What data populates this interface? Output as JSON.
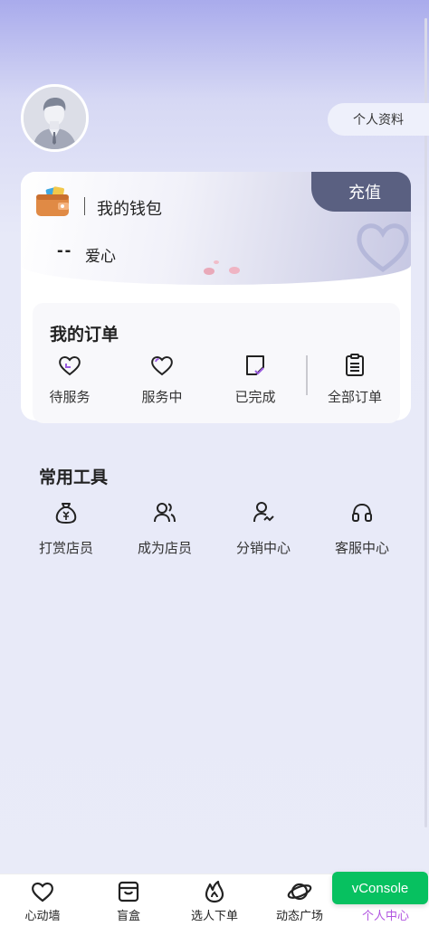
{
  "profile": {
    "profile_button_label": "个人资料"
  },
  "wallet": {
    "title": "我的钱包",
    "recharge_label": "充值",
    "balance": "--",
    "unit": "爱心"
  },
  "orders": {
    "title": "我的订单",
    "items": [
      {
        "label": "待服务",
        "icon": "heart-check-icon"
      },
      {
        "label": "服务中",
        "icon": "heart-icon"
      },
      {
        "label": "已完成",
        "icon": "document-check-icon"
      },
      {
        "label": "全部订单",
        "icon": "clipboard-list-icon"
      }
    ]
  },
  "tools": {
    "title": "常用工具",
    "items": [
      {
        "label": "打赏店员",
        "icon": "money-bag-icon"
      },
      {
        "label": "成为店员",
        "icon": "users-icon"
      },
      {
        "label": "分销中心",
        "icon": "user-share-icon"
      },
      {
        "label": "客服中心",
        "icon": "headset-icon"
      }
    ]
  },
  "tabbar": {
    "items": [
      {
        "label": "心动墙",
        "icon": "heart-icon"
      },
      {
        "label": "盲盒",
        "icon": "box-icon"
      },
      {
        "label": "选人下单",
        "icon": "flame-icon"
      },
      {
        "label": "动态广场",
        "icon": "planet-icon"
      },
      {
        "label": "个人中心",
        "icon": "user-icon"
      }
    ],
    "active_index": 4,
    "active_color": "#b155e0"
  },
  "vconsole": {
    "label": "vConsole",
    "color": "#07c160"
  }
}
